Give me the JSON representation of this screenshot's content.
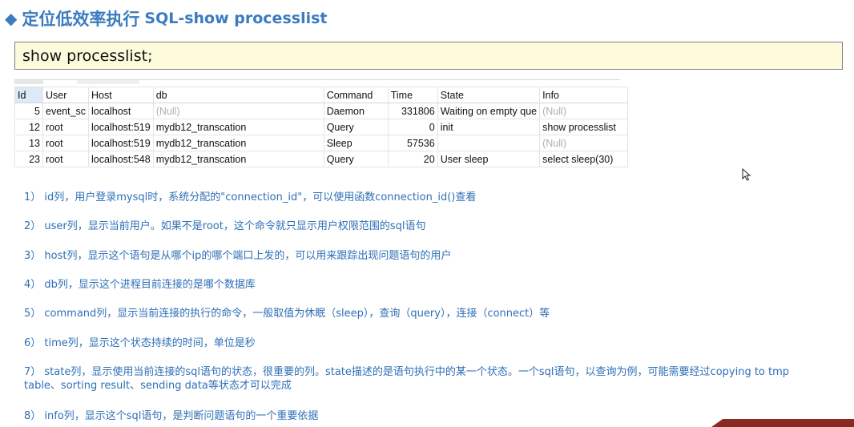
{
  "header": {
    "bullet_icon": "diamond-icon",
    "title_cn": "定位低效率执行",
    "title_code": "SQL-show processlist"
  },
  "command": "show processlist;",
  "table": {
    "columns": [
      "Id",
      "User",
      "Host",
      "db",
      "Command",
      "Time",
      "State",
      "Info"
    ],
    "rows": [
      {
        "id": "5",
        "user": "event_sc",
        "host": "localhost",
        "db": "(Null)",
        "command": "Daemon",
        "time": "331806",
        "state": "Waiting on empty que",
        "info": "(Null)"
      },
      {
        "id": "12",
        "user": "root",
        "host": "localhost:519",
        "db": "mydb12_transcation",
        "command": "Query",
        "time": "0",
        "state": "init",
        "info": "show processlist"
      },
      {
        "id": "13",
        "user": "root",
        "host": "localhost:519",
        "db": "mydb12_transcation",
        "command": "Sleep",
        "time": "57536",
        "state": "",
        "info": "(Null)"
      },
      {
        "id": "23",
        "user": "root",
        "host": "localhost:548",
        "db": "mydb12_transcation",
        "command": "Query",
        "time": "20",
        "state": "User sleep",
        "info": "select sleep(30)"
      }
    ]
  },
  "notes": [
    "1） id列，用户登录mysql时，系统分配的\"connection_id\"，可以使用函数connection_id()查看",
    "2） user列，显示当前用户。如果不是root，这个命令就只显示用户权限范围的sql语句",
    "3） host列，显示这个语句是从哪个ip的哪个端口上发的，可以用来跟踪出现问题语句的用户",
    "4） db列，显示这个进程目前连接的是哪个数据库",
    "5） command列，显示当前连接的执行的命令，一般取值为休眠（sleep），查询（query），连接（connect）等",
    "6） time列，显示这个状态持续的时间，单位是秒",
    "7） state列，显示使用当前连接的sql语句的状态，很重要的列。state描述的是语句执行中的某一个状态。一个sql语句，以查询为例，可能需要经过copying to tmp table、sorting result、sending data等状态才可以完成",
    "8） info列，显示这个sql语句，是判断问题语句的一个重要依据"
  ],
  "colors": {
    "accent": "#3b7bbf",
    "note_text": "#2e6fb7",
    "command_bg": "#fdfbdc",
    "null_text": "#b0b0b0"
  }
}
